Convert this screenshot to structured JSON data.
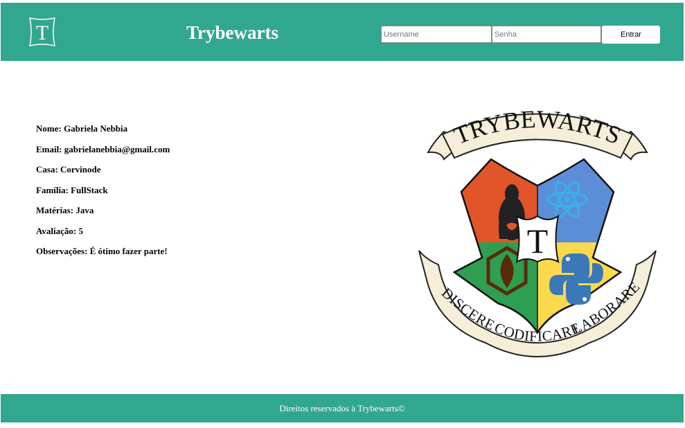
{
  "header": {
    "logo_letter": "T",
    "title": "Trybewarts",
    "username_placeholder": "Username",
    "password_placeholder": "Senha",
    "login_button": "Entrar"
  },
  "form_data": {
    "lines": [
      "Nome: Gabriela Nebbia",
      "Email: gabrielanebbia@gmail.com",
      "Casa: Corvinode",
      "Família: FullStack",
      "Matérias: Java",
      "Avaliação: 5",
      "Observações: É ótimo fazer parte!"
    ]
  },
  "crest": {
    "banner_top": "TRYBEWARTS",
    "center_letter": "T",
    "motto_left": "DISCERE",
    "motto_middle": "CODIFICARE",
    "motto_right": "LABORARE",
    "colors": {
      "orange": "#e2552a",
      "blue": "#5b8ed6",
      "green": "#2e9e51",
      "yellow": "#fbd84c",
      "ribbon": "#f5eed8"
    }
  },
  "footer": {
    "text": "Direitos reservados à Trybewarts©"
  },
  "theme": {
    "primary": "#31a78f",
    "text": "#000000"
  }
}
